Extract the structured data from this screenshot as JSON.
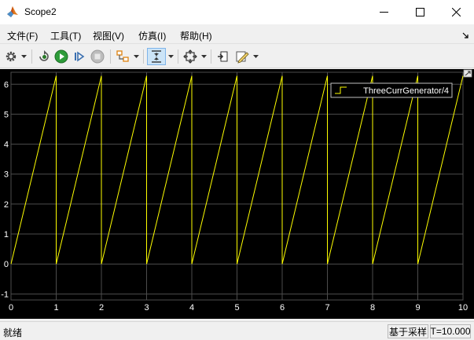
{
  "window": {
    "title": "Scope2",
    "icon": "matlab-icon",
    "controls": [
      "minimize-icon",
      "maximize-icon",
      "close-icon"
    ]
  },
  "menu": {
    "items": [
      "文件(F)",
      "工具(T)",
      "视图(V)",
      "仿真(I)",
      "帮助(H)"
    ],
    "dock_icon": "dock-arrow-icon"
  },
  "toolbar": {
    "buttons": [
      "settings-icon",
      "dropdown-icon",
      "restore-icon",
      "run-icon",
      "step-forward-icon",
      "stop-icon",
      "highlight-block-icon",
      "dropdown-icon",
      "cursor-zoom-icon",
      "dropdown-icon",
      "autoscale-icon",
      "dropdown-icon",
      "write-data-icon",
      "edit-icon",
      "dropdown-icon"
    ]
  },
  "status": {
    "left_text": "就绪",
    "mode": "基于采样",
    "time": "T=10.000"
  },
  "colors": {
    "plot_background": "#000000",
    "grid": "#4d4d4d",
    "trace": "#ffff00",
    "axes_text": "#ffffff"
  },
  "chart_data": {
    "type": "line",
    "title": "",
    "xlabel": "",
    "ylabel": "",
    "xlim": [
      0,
      10
    ],
    "ylim": [
      -1.2,
      6.4
    ],
    "x_ticks": [
      "0",
      "1",
      "2",
      "3",
      "4",
      "5",
      "6",
      "7",
      "8",
      "9",
      "10"
    ],
    "y_ticks": [
      "-1",
      "0",
      "1",
      "2",
      "3",
      "4",
      "5",
      "6"
    ],
    "grid": true,
    "legend_position": "top-right",
    "series": [
      {
        "name": "ThreeCurrGenerator/4",
        "color": "#ffff00",
        "x": [
          0,
          1,
          1,
          2,
          2,
          3,
          3,
          4,
          4,
          5,
          5,
          6,
          6,
          7,
          7,
          8,
          8,
          9,
          9,
          10
        ],
        "y": [
          0,
          6.28,
          0,
          6.28,
          0,
          6.28,
          0,
          6.28,
          0,
          6.28,
          0,
          6.28,
          0,
          6.28,
          0,
          6.28,
          0,
          6.28,
          0,
          6.28
        ]
      }
    ]
  }
}
